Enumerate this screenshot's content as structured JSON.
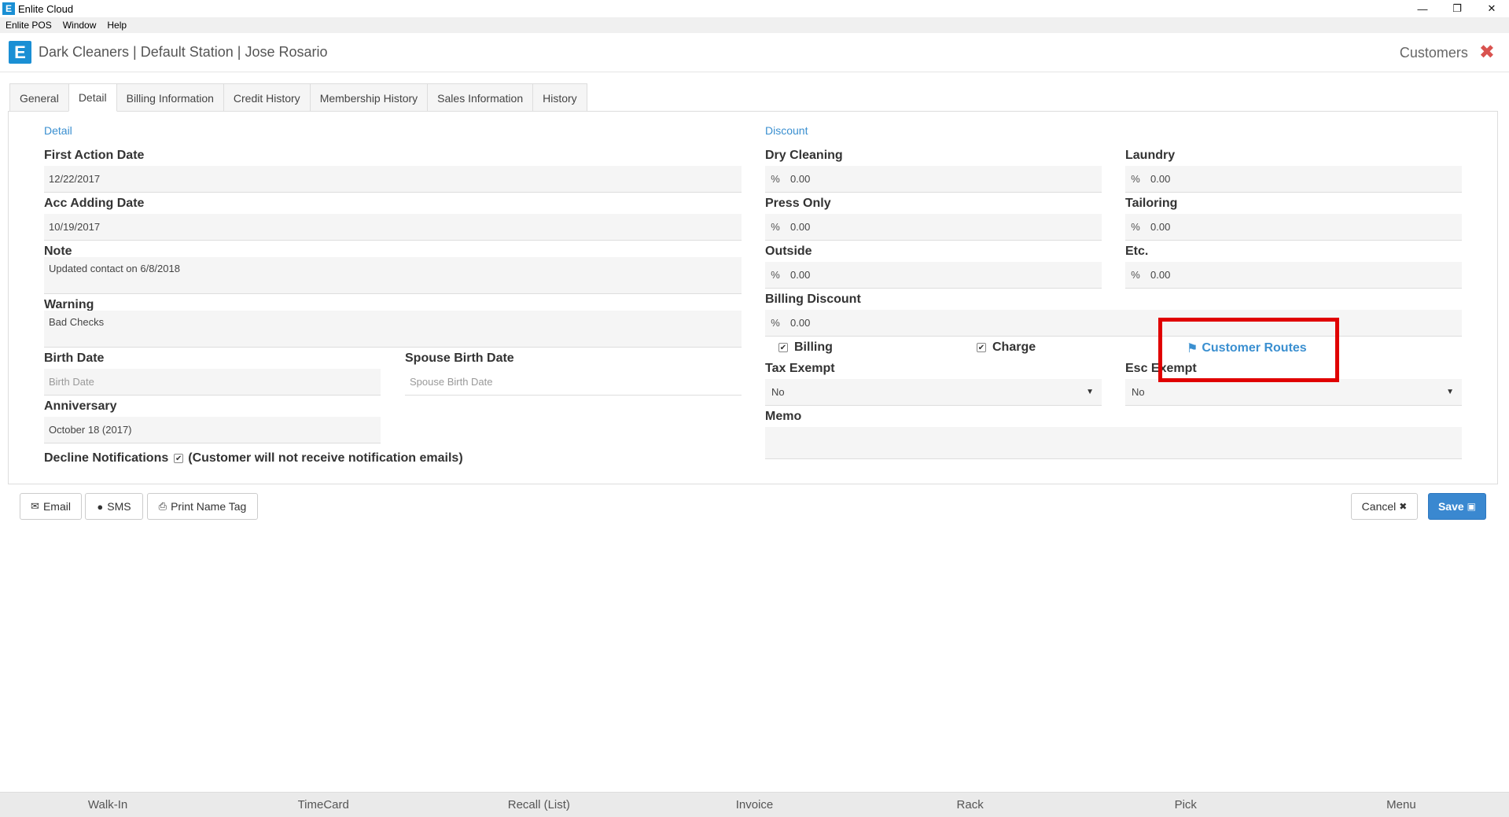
{
  "window": {
    "title": "Enlite Cloud",
    "menu": [
      "Enlite POS",
      "Window",
      "Help"
    ]
  },
  "header": {
    "title": "Dark Cleaners | Default Station | Jose Rosario",
    "page_name": "Customers"
  },
  "tabs": [
    "General",
    "Detail",
    "Billing Information",
    "Credit History",
    "Membership History",
    "Sales Information",
    "History"
  ],
  "active_tab": "Detail",
  "detail": {
    "section_label": "Detail",
    "first_action_date_label": "First Action Date",
    "first_action_date": "12/22/2017",
    "acc_adding_date_label": "Acc Adding Date",
    "acc_adding_date": "10/19/2017",
    "note_label": "Note",
    "note": "Updated contact on 6/8/2018",
    "warning_label": "Warning",
    "warning": "Bad Checks",
    "birth_date_label": "Birth Date",
    "birth_date_placeholder": "Birth Date",
    "spouse_birth_date_label": "Spouse Birth Date",
    "spouse_birth_date_placeholder": "Spouse Birth Date",
    "anniversary_label": "Anniversary",
    "anniversary": "October 18 (2017)",
    "decline_label": "Decline Notifications",
    "decline_note": "(Customer will not receive notification emails)"
  },
  "discount": {
    "section_label": "Discount",
    "percent_symbol": "%",
    "dry_cleaning_label": "Dry Cleaning",
    "dry_cleaning": "0.00",
    "laundry_label": "Laundry",
    "laundry": "0.00",
    "press_only_label": "Press Only",
    "press_only": "0.00",
    "tailoring_label": "Tailoring",
    "tailoring": "0.00",
    "outside_label": "Outside",
    "outside": "0.00",
    "etc_label": "Etc.",
    "etc": "0.00",
    "billing_discount_label": "Billing Discount",
    "billing_discount": "0.00",
    "billing_label": "Billing",
    "charge_label": "Charge",
    "customer_routes_label": "Customer Routes",
    "tax_exempt_label": "Tax Exempt",
    "tax_exempt": "No",
    "esc_exempt_label": "Esc Exempt",
    "esc_exempt": "No",
    "memo_label": "Memo",
    "memo": ""
  },
  "actions": {
    "email": "Email",
    "sms": "SMS",
    "print_name_tag": "Print Name Tag",
    "cancel": "Cancel",
    "save": "Save"
  },
  "footer": [
    "Walk-In",
    "TimeCard",
    "Recall (List)",
    "Invoice",
    "Rack",
    "Pick",
    "Menu"
  ],
  "colors": {
    "accent": "#3a8fd0",
    "primary_button": "#3a88d0",
    "close_red": "#d9534f",
    "highlight_red": "#e00000"
  }
}
